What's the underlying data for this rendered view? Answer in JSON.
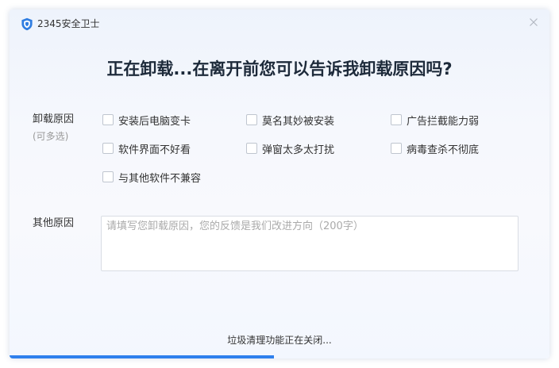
{
  "window": {
    "app_title": "2345安全卫士",
    "close_icon": "close-icon",
    "logo_icon": "shield-icon"
  },
  "headline": "正在卸载...在离开前您可以告诉我卸载原因吗?",
  "reasons": {
    "label": "卸载原因",
    "sublabel": "(可多选)",
    "options": [
      {
        "label": "安装后电脑变卡",
        "checked": false
      },
      {
        "label": "莫名其妙被安装",
        "checked": false
      },
      {
        "label": "广告拦截能力弱",
        "checked": false
      },
      {
        "label": "软件界面不好看",
        "checked": false
      },
      {
        "label": "弹窗太多太打扰",
        "checked": false
      },
      {
        "label": "病毒查杀不彻底",
        "checked": false
      },
      {
        "label": "与其他软件不兼容",
        "checked": false
      }
    ]
  },
  "other": {
    "label": "其他原因",
    "placeholder": "请填写您卸载原因，您的反馈是我们改进方向（200字）",
    "value": ""
  },
  "status": {
    "text": "垃圾清理功能正在关闭...",
    "progress": 0.49
  },
  "colors": {
    "accent": "#2f80ed",
    "heading": "#1d2a3a"
  }
}
